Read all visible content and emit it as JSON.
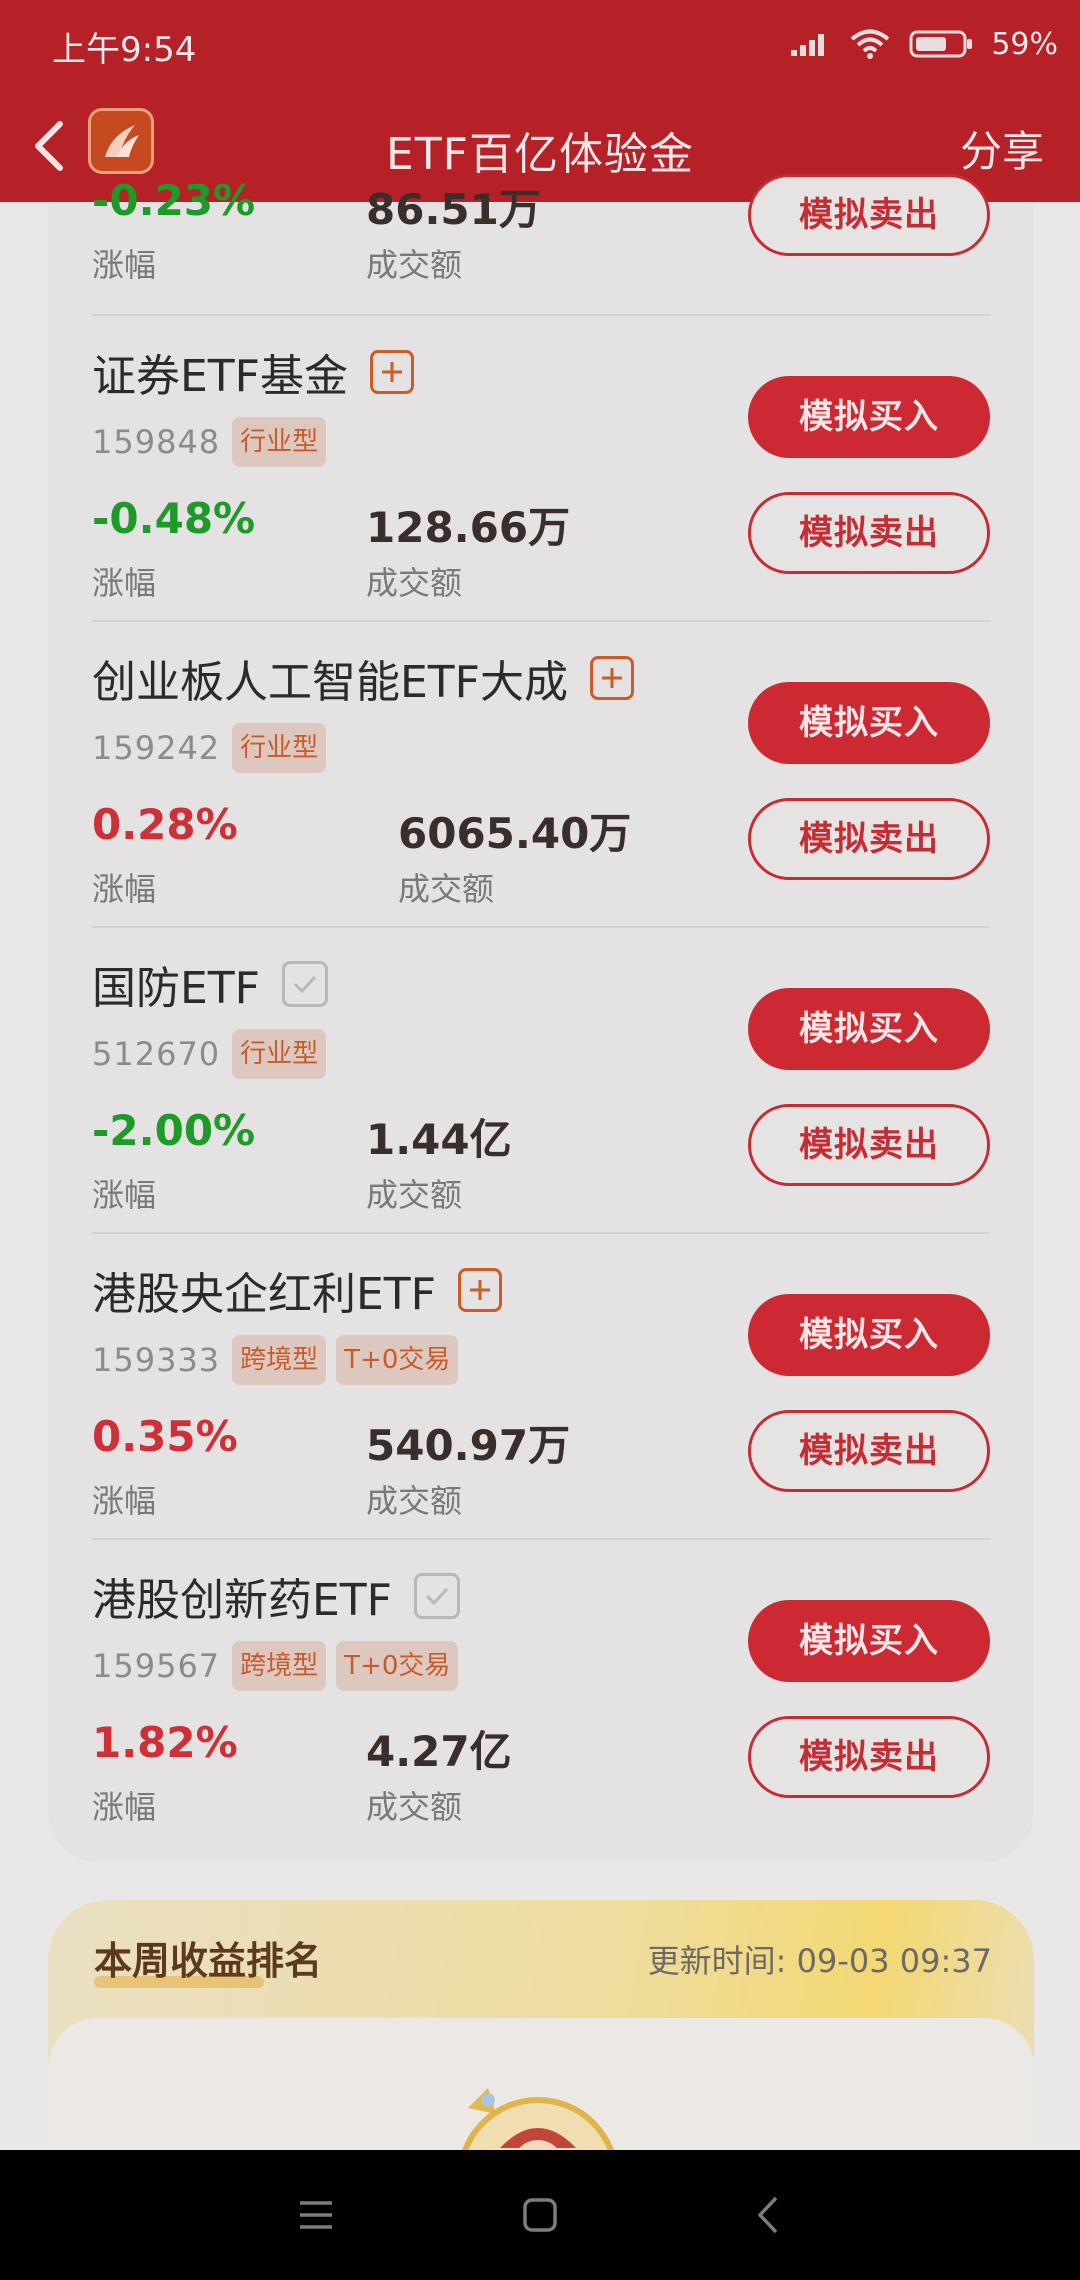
{
  "status_bar": {
    "time": "上午9:54",
    "battery": "59%"
  },
  "header": {
    "title": "ETF百亿体验金",
    "share": "分享"
  },
  "labels": {
    "change": "涨幅",
    "volume": "成交额",
    "buy": "模拟买入",
    "sell": "模拟卖出"
  },
  "partial_item": {
    "change": "-0.23%",
    "volume": "86.51万"
  },
  "funds": [
    {
      "name": "证券ETF基金",
      "code": "159848",
      "tags": [
        "行业型"
      ],
      "change": "-0.48%",
      "volume": "128.66万",
      "watch": "add"
    },
    {
      "name": "创业板人工智能ETF大成",
      "code": "159242",
      "tags": [
        "行业型"
      ],
      "change": "0.28%",
      "volume": "6065.40万",
      "watch": "add"
    },
    {
      "name": "国防ETF",
      "code": "512670",
      "tags": [
        "行业型"
      ],
      "change": "-2.00%",
      "volume": "1.44亿",
      "watch": "added"
    },
    {
      "name": "港股央企红利ETF",
      "code": "159333",
      "tags": [
        "跨境型",
        "T+0交易"
      ],
      "change": "0.35%",
      "volume": "540.97万",
      "watch": "add"
    },
    {
      "name": "港股创新药ETF",
      "code": "159567",
      "tags": [
        "跨境型",
        "T+0交易"
      ],
      "change": "1.82%",
      "volume": "4.27亿",
      "watch": "added"
    }
  ],
  "ranking": {
    "title": "本周收益排名",
    "updated": "更新时间: 09-03 09:37"
  },
  "colors": {
    "brand_red": "#b62027",
    "up": "#cf2f36",
    "down": "#1d9a28"
  },
  "icons": [
    "back-arrow-icon",
    "app-logo-icon",
    "add-watchlist-icon",
    "added-check-icon",
    "menu-icon",
    "home-square-icon",
    "nav-back-icon"
  ]
}
